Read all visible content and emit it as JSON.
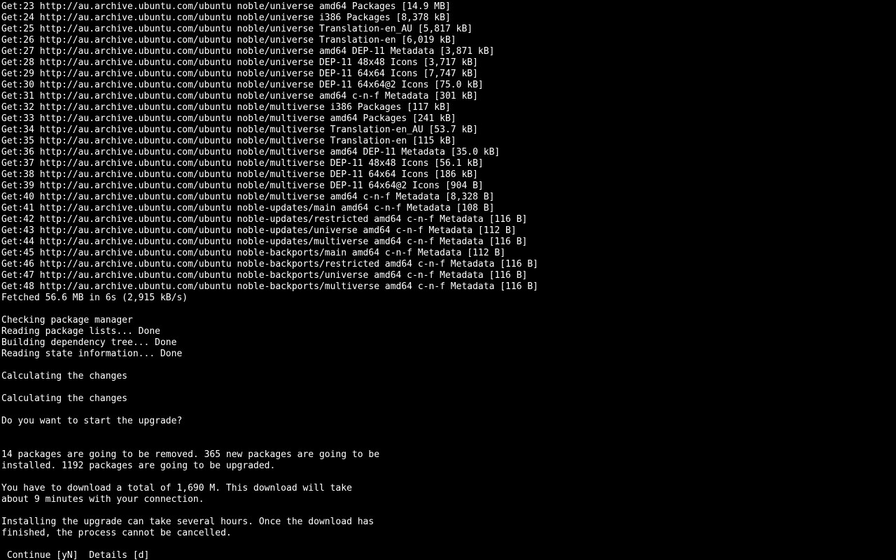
{
  "get_lines": [
    {
      "n": 23,
      "url": "http://au.archive.ubuntu.com/ubuntu",
      "suite": "noble/universe",
      "arch": "amd64",
      "component": "Packages",
      "size": "14.9 MB"
    },
    {
      "n": 24,
      "url": "http://au.archive.ubuntu.com/ubuntu",
      "suite": "noble/universe",
      "arch": "i386",
      "component": "Packages",
      "size": "8,378 kB"
    },
    {
      "n": 25,
      "url": "http://au.archive.ubuntu.com/ubuntu",
      "suite": "noble/universe",
      "arch": "",
      "component": "Translation-en_AU",
      "size": "5,817 kB"
    },
    {
      "n": 26,
      "url": "http://au.archive.ubuntu.com/ubuntu",
      "suite": "noble/universe",
      "arch": "",
      "component": "Translation-en",
      "size": "6,019 kB"
    },
    {
      "n": 27,
      "url": "http://au.archive.ubuntu.com/ubuntu",
      "suite": "noble/universe",
      "arch": "amd64",
      "component": "DEP-11 Metadata",
      "size": "3,871 kB"
    },
    {
      "n": 28,
      "url": "http://au.archive.ubuntu.com/ubuntu",
      "suite": "noble/universe",
      "arch": "",
      "component": "DEP-11 48x48 Icons",
      "size": "3,717 kB"
    },
    {
      "n": 29,
      "url": "http://au.archive.ubuntu.com/ubuntu",
      "suite": "noble/universe",
      "arch": "",
      "component": "DEP-11 64x64 Icons",
      "size": "7,747 kB"
    },
    {
      "n": 30,
      "url": "http://au.archive.ubuntu.com/ubuntu",
      "suite": "noble/universe",
      "arch": "",
      "component": "DEP-11 64x64@2 Icons",
      "size": "75.0 kB"
    },
    {
      "n": 31,
      "url": "http://au.archive.ubuntu.com/ubuntu",
      "suite": "noble/universe",
      "arch": "amd64",
      "component": "c-n-f Metadata",
      "size": "301 kB"
    },
    {
      "n": 32,
      "url": "http://au.archive.ubuntu.com/ubuntu",
      "suite": "noble/multiverse",
      "arch": "i386",
      "component": "Packages",
      "size": "117 kB"
    },
    {
      "n": 33,
      "url": "http://au.archive.ubuntu.com/ubuntu",
      "suite": "noble/multiverse",
      "arch": "amd64",
      "component": "Packages",
      "size": "241 kB"
    },
    {
      "n": 34,
      "url": "http://au.archive.ubuntu.com/ubuntu",
      "suite": "noble/multiverse",
      "arch": "",
      "component": "Translation-en_AU",
      "size": "53.7 kB"
    },
    {
      "n": 35,
      "url": "http://au.archive.ubuntu.com/ubuntu",
      "suite": "noble/multiverse",
      "arch": "",
      "component": "Translation-en",
      "size": "115 kB"
    },
    {
      "n": 36,
      "url": "http://au.archive.ubuntu.com/ubuntu",
      "suite": "noble/multiverse",
      "arch": "amd64",
      "component": "DEP-11 Metadata",
      "size": "35.0 kB"
    },
    {
      "n": 37,
      "url": "http://au.archive.ubuntu.com/ubuntu",
      "suite": "noble/multiverse",
      "arch": "",
      "component": "DEP-11 48x48 Icons",
      "size": "56.1 kB"
    },
    {
      "n": 38,
      "url": "http://au.archive.ubuntu.com/ubuntu",
      "suite": "noble/multiverse",
      "arch": "",
      "component": "DEP-11 64x64 Icons",
      "size": "186 kB"
    },
    {
      "n": 39,
      "url": "http://au.archive.ubuntu.com/ubuntu",
      "suite": "noble/multiverse",
      "arch": "",
      "component": "DEP-11 64x64@2 Icons",
      "size": "904 B"
    },
    {
      "n": 40,
      "url": "http://au.archive.ubuntu.com/ubuntu",
      "suite": "noble/multiverse",
      "arch": "amd64",
      "component": "c-n-f Metadata",
      "size": "8,328 B"
    },
    {
      "n": 41,
      "url": "http://au.archive.ubuntu.com/ubuntu",
      "suite": "noble-updates/main",
      "arch": "amd64",
      "component": "c-n-f Metadata",
      "size": "108 B"
    },
    {
      "n": 42,
      "url": "http://au.archive.ubuntu.com/ubuntu",
      "suite": "noble-updates/restricted",
      "arch": "amd64",
      "component": "c-n-f Metadata",
      "size": "116 B"
    },
    {
      "n": 43,
      "url": "http://au.archive.ubuntu.com/ubuntu",
      "suite": "noble-updates/universe",
      "arch": "amd64",
      "component": "c-n-f Metadata",
      "size": "112 B"
    },
    {
      "n": 44,
      "url": "http://au.archive.ubuntu.com/ubuntu",
      "suite": "noble-updates/multiverse",
      "arch": "amd64",
      "component": "c-n-f Metadata",
      "size": "116 B"
    },
    {
      "n": 45,
      "url": "http://au.archive.ubuntu.com/ubuntu",
      "suite": "noble-backports/main",
      "arch": "amd64",
      "component": "c-n-f Metadata",
      "size": "112 B"
    },
    {
      "n": 46,
      "url": "http://au.archive.ubuntu.com/ubuntu",
      "suite": "noble-backports/restricted",
      "arch": "amd64",
      "component": "c-n-f Metadata",
      "size": "116 B"
    },
    {
      "n": 47,
      "url": "http://au.archive.ubuntu.com/ubuntu",
      "suite": "noble-backports/universe",
      "arch": "amd64",
      "component": "c-n-f Metadata",
      "size": "116 B"
    },
    {
      "n": 48,
      "url": "http://au.archive.ubuntu.com/ubuntu",
      "suite": "noble-backports/multiverse",
      "arch": "amd64",
      "component": "c-n-f Metadata",
      "size": "116 B"
    }
  ],
  "fetched_line": "Fetched 56.6 MB in 6s (2,915 kB/s)",
  "status_lines": [
    "",
    "Checking package manager",
    "Reading package lists... Done",
    "Building dependency tree... Done",
    "Reading state information... Done",
    "",
    "Calculating the changes",
    "",
    "Calculating the changes",
    "",
    "Do you want to start the upgrade?",
    "",
    "",
    "14 packages are going to be removed. 365 new packages are going to be",
    "installed. 1192 packages are going to be upgraded.",
    "",
    "You have to download a total of 1,690 M. This download will take",
    "about 9 minutes with your connection.",
    "",
    "Installing the upgrade can take several hours. Once the download has",
    "finished, the process cannot be cancelled.",
    ""
  ],
  "prompt_line": " Continue [yN]  Details [d]"
}
